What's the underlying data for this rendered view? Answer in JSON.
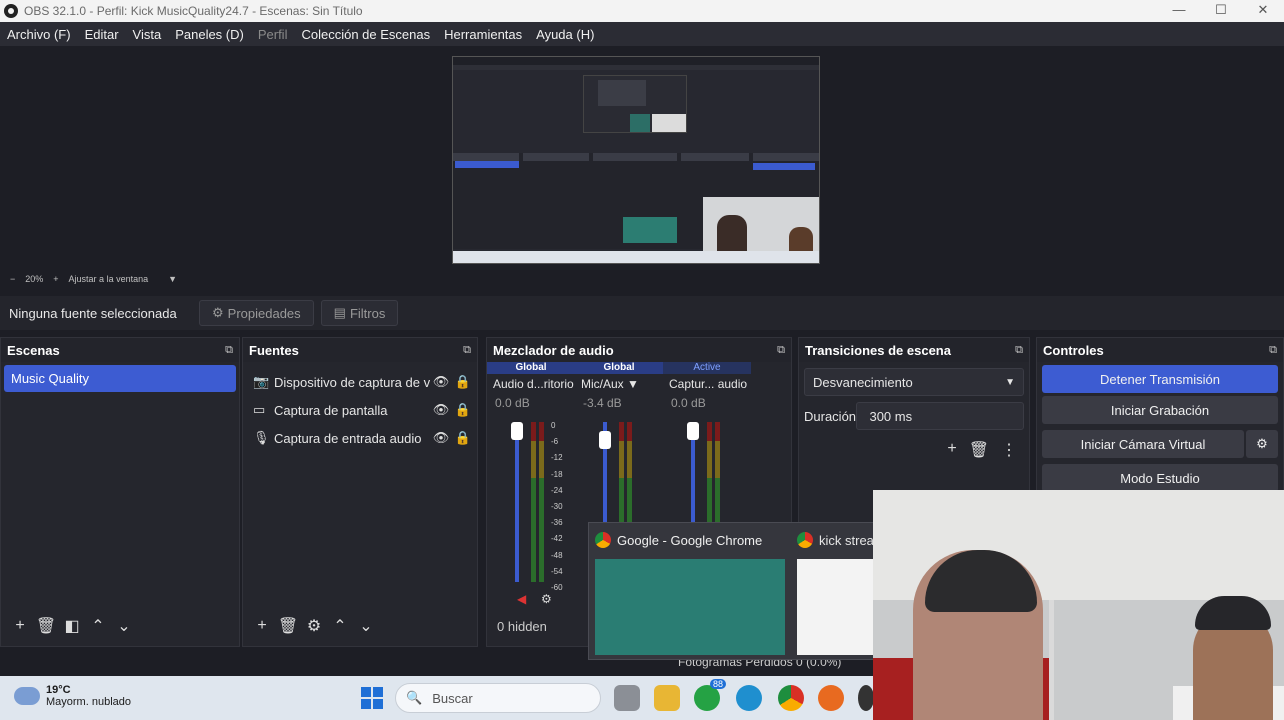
{
  "window": {
    "title": "OBS 32.1.0 - Perfil: Kick MusicQuality24.7 - Escenas: Sin Título",
    "minimize": "—",
    "maximize": "☐",
    "close": "✕"
  },
  "menu": [
    {
      "label": "Archivo (F)"
    },
    {
      "label": "Editar"
    },
    {
      "label": "Vista"
    },
    {
      "label": "Paneles (D)"
    },
    {
      "label": "Perfil",
      "disabled": true
    },
    {
      "label": "Colección de Escenas"
    },
    {
      "label": "Herramientas"
    },
    {
      "label": "Ayuda (H)"
    }
  ],
  "preview": {
    "zoom_minus": "−",
    "zoom": "20%",
    "zoom_plus": "+",
    "fit": "Ajustar a la ventana"
  },
  "propbar": {
    "no_selection": "Ninguna fuente seleccionada",
    "properties": "Propiedades",
    "filters": "Filtros"
  },
  "scenes": {
    "title": "Escenas",
    "items": [
      "Music Quality"
    ]
  },
  "sources": {
    "title": "Fuentes",
    "items": [
      {
        "icon": "camera-icon",
        "label": "Dispositivo de captura de video"
      },
      {
        "icon": "monitor-icon",
        "label": "Captura de pantalla"
      },
      {
        "icon": "microphone-icon",
        "label": "Captura de entrada audio"
      }
    ]
  },
  "mixer": {
    "title": "Mezclador de audio",
    "channels": [
      {
        "tag": "Global",
        "name": "Audio d...ritorio",
        "db": "0.0 dB",
        "fader": 0.0
      },
      {
        "tag": "Global",
        "name": "Mic/Aux",
        "db": "-3.4 dB",
        "fader": -3.4
      },
      {
        "tag": "Active",
        "name": "Captur... audio",
        "db": "0.0 dB",
        "fader": 0.0
      }
    ],
    "scale": [
      "0",
      "-6",
      "-12",
      "-18",
      "-24",
      "-30",
      "-36",
      "-42",
      "-48",
      "-54",
      "-60"
    ],
    "hidden": "0 hidden"
  },
  "transitions": {
    "title": "Transiciones de escena",
    "selected": "Desvanecimiento",
    "duration_label": "Duración",
    "duration_value": "300 ms"
  },
  "controls": {
    "title": "Controles",
    "stop_stream": "Detener Transmisión",
    "start_recording": "Iniciar Grabación",
    "virtual_cam": "Iniciar Cámara Virtual",
    "studio_mode": "Modo Estudio"
  },
  "status": {
    "dropped_frames": "Fotogramas Perdidos 0 (0.0%)"
  },
  "taskview": {
    "window1": "Google - Google Chrome",
    "window2": "kick strea"
  },
  "taskbar": {
    "temp": "19°C",
    "weather": "Mayorm. nublado",
    "search_placeholder": "Buscar",
    "whatsapp_badge": "88"
  },
  "colors": {
    "accent": "#3d5cd2",
    "background": "#1d1e25",
    "dock": "#25262d"
  }
}
